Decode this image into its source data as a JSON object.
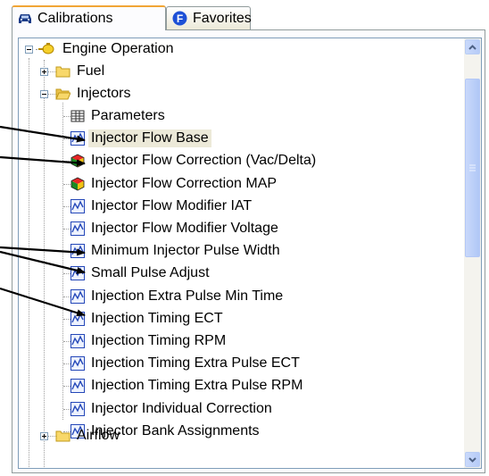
{
  "tabs": [
    {
      "label": "Calibrations",
      "icon": "car-icon",
      "active": true
    },
    {
      "label": "Favorites",
      "icon": "favorites-f-icon",
      "active": false
    }
  ],
  "tree": {
    "root": {
      "label": "Engine Operation",
      "icon": "engine-icon",
      "expanded": true
    },
    "fuel": {
      "label": "Fuel",
      "icon": "folder-icon",
      "expanded": false
    },
    "injectors": {
      "label": "Injectors",
      "icon": "folder-open-icon",
      "expanded": true,
      "items": [
        {
          "label": "Parameters",
          "icon": "table-icon"
        },
        {
          "label": "Injector Flow Base",
          "icon": "graph-icon",
          "selected": true
        },
        {
          "label": "Injector Flow Correction (Vac/Delta)",
          "icon": "3d-cube-icon"
        },
        {
          "label": "Injector Flow Correction MAP",
          "icon": "3d-cube-icon"
        },
        {
          "label": "Injector Flow Modifier IAT",
          "icon": "graph-icon"
        },
        {
          "label": "Injector Flow Modifier Voltage",
          "icon": "graph-icon"
        },
        {
          "label": "Minimum Injector Pulse Width",
          "icon": "graph-icon"
        },
        {
          "label": "Small Pulse Adjust",
          "icon": "graph-icon"
        },
        {
          "label": "Injection Extra Pulse Min Time",
          "icon": "graph-icon"
        },
        {
          "label": "Injection Timing ECT",
          "icon": "graph-icon"
        },
        {
          "label": "Injection Timing RPM",
          "icon": "graph-icon"
        },
        {
          "label": "Injection Timing Extra Pulse ECT",
          "icon": "graph-icon"
        },
        {
          "label": "Injection Timing Extra Pulse RPM",
          "icon": "graph-icon"
        },
        {
          "label": "Injector Individual Correction",
          "icon": "graph-icon"
        },
        {
          "label": "Injector Bank Assignments",
          "icon": "graph-icon"
        }
      ]
    },
    "airflow": {
      "label": "Airflow",
      "icon": "folder-icon",
      "expanded": false
    }
  },
  "colors": {
    "selection": "#ece9d8",
    "scrollbar": "#c1d3fb",
    "arrow": "#000000",
    "active_tab_accent": "#f1a535"
  }
}
